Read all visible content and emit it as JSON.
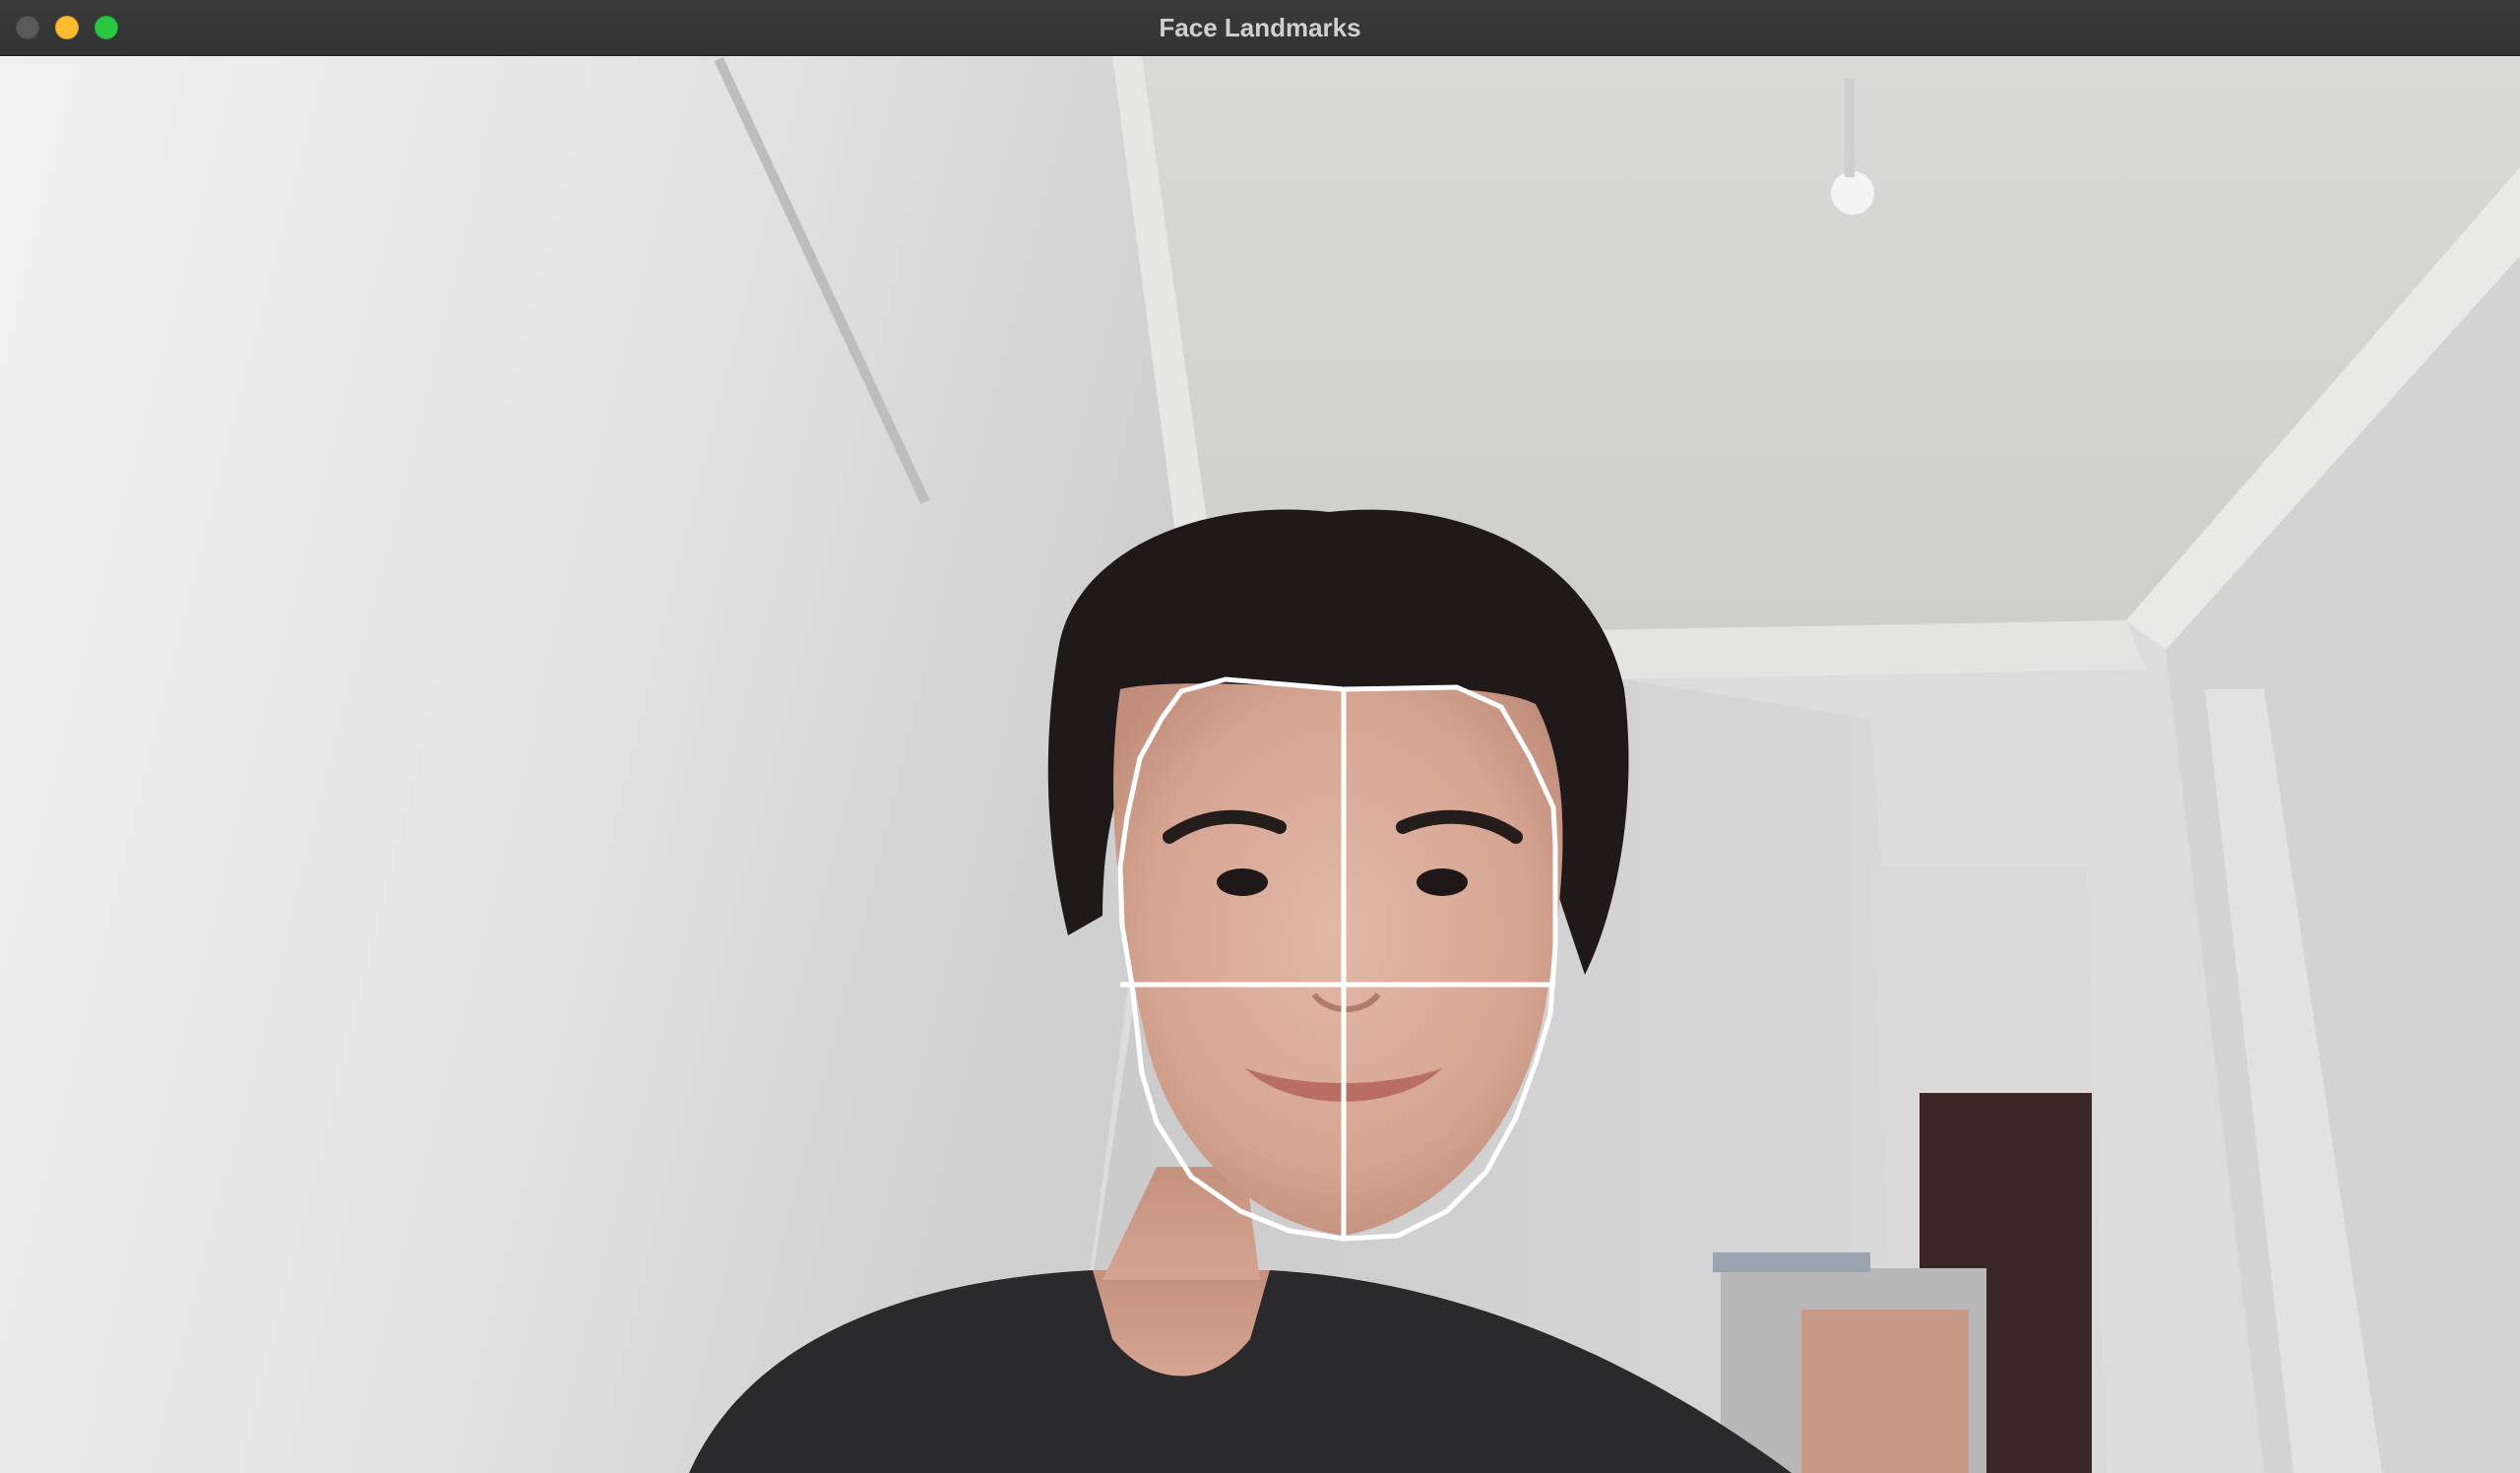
{
  "window": {
    "title": "Face Landmarks"
  },
  "colors": {
    "titlebar": "#353535",
    "title_text": "#d0d0d0",
    "minimize": "#febc2e",
    "zoom": "#28c840",
    "overlay": "#ffffff"
  },
  "camera_feed": {
    "overlay": "face-outline-with-center-cross"
  }
}
